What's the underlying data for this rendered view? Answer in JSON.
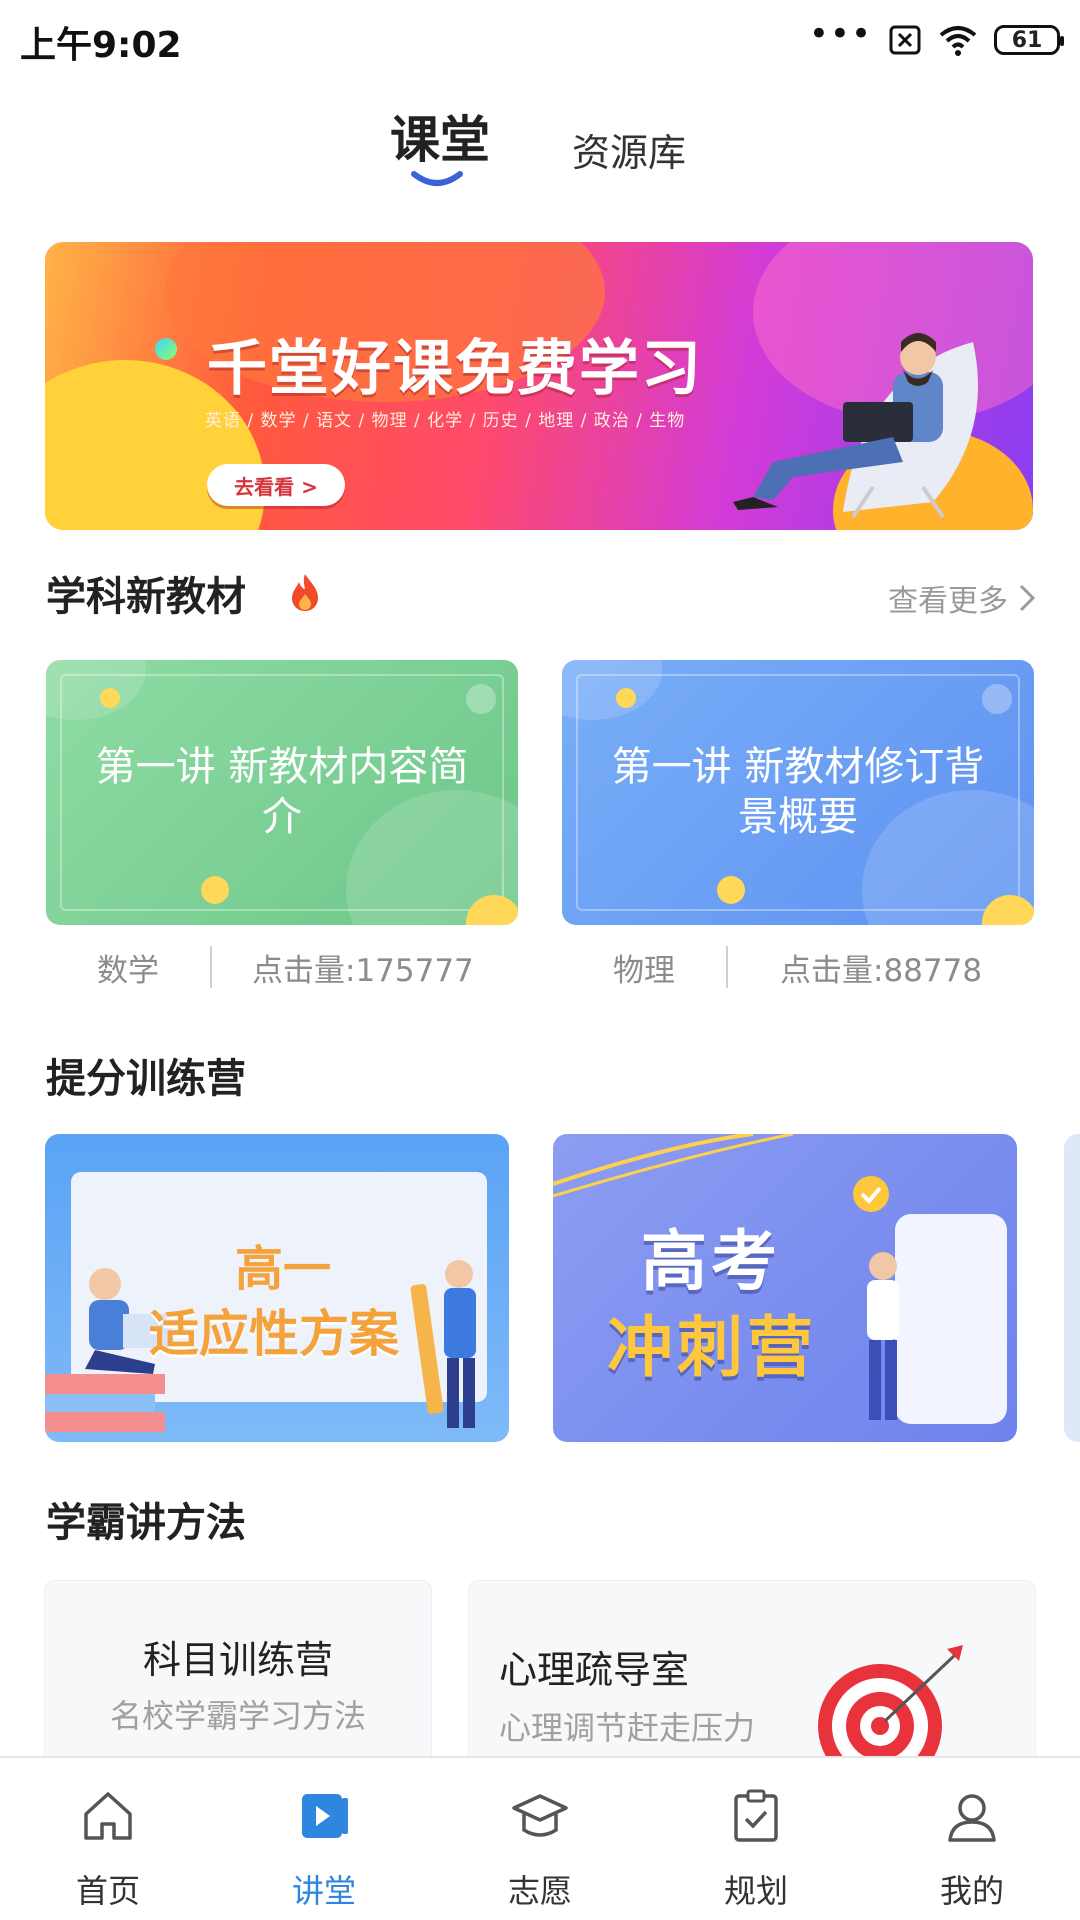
{
  "status_bar": {
    "time": "上午9:02",
    "battery": "61"
  },
  "top_tabs": {
    "active": "课堂",
    "inactive": "资源库"
  },
  "banner": {
    "title": "千堂好课免费学习",
    "subjects": "英语 / 数学 / 语文 / 物理 / 化学 / 历史 / 地理 / 政治 / 生物",
    "button": "去看看 >"
  },
  "new_textbooks": {
    "title": "学科新教材",
    "see_more": "查看更多",
    "courses": [
      {
        "title": "第一讲 新教材内容简介",
        "subject": "数学",
        "clicks": "点击量:175777"
      },
      {
        "title": "第一讲 新教材修订背景概要",
        "subject": "物理",
        "clicks": "点击量:88778"
      }
    ]
  },
  "training_camp": {
    "title": "提分训练营",
    "cards": [
      {
        "line1": "高一",
        "line2": "适应性方案"
      },
      {
        "line1": "高考",
        "line2": "冲刺营"
      }
    ]
  },
  "methods": {
    "title": "学霸讲方法",
    "cards": [
      {
        "title": "科目训练营",
        "subtitle": "名校学霸学习方法"
      },
      {
        "title": "心理疏导室",
        "subtitle": "心理调节赶走压力"
      }
    ]
  },
  "bottom_nav": [
    {
      "label": "首页",
      "icon": "home-icon"
    },
    {
      "label": "讲堂",
      "icon": "play-icon",
      "active": true
    },
    {
      "label": "志愿",
      "icon": "graduation-cap-icon"
    },
    {
      "label": "规划",
      "icon": "clipboard-check-icon"
    },
    {
      "label": "我的",
      "icon": "user-icon"
    }
  ],
  "colors": {
    "accent": "#2f86e0",
    "tab_indicator": "#3a63d8"
  }
}
